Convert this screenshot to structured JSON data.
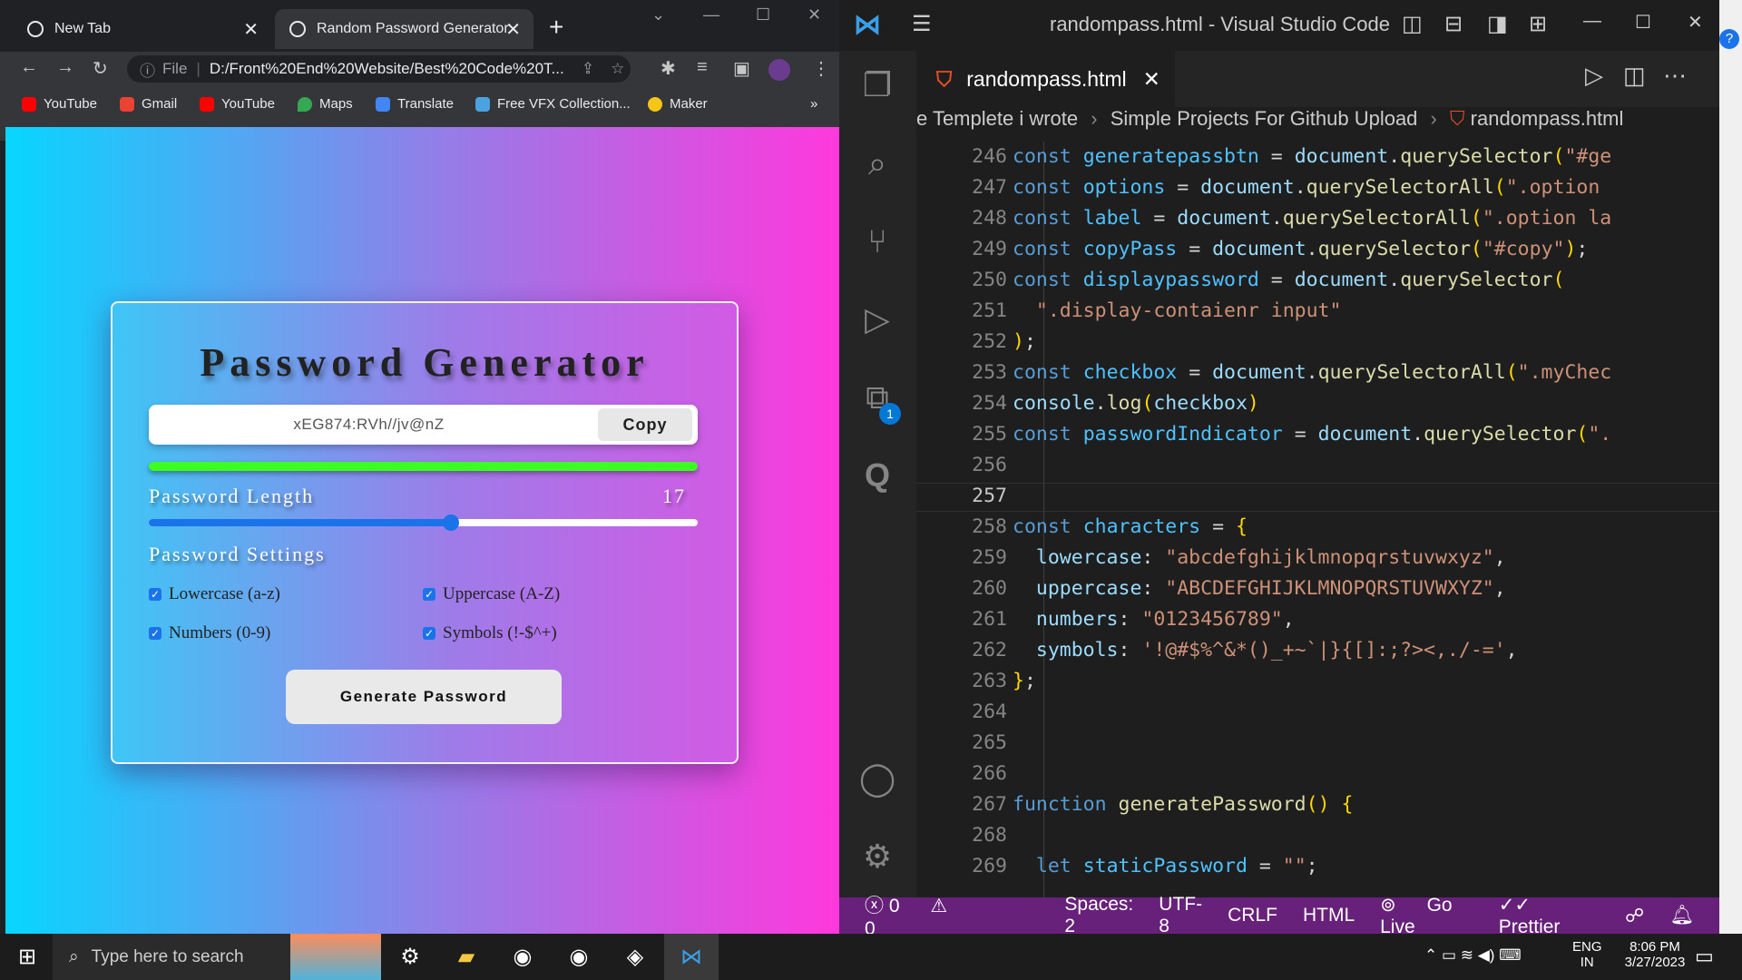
{
  "browser": {
    "tabs": [
      {
        "label": "New Tab"
      },
      {
        "label": "Random Password Generator"
      }
    ],
    "url": "D:/Front%20End%20Website/Best%20Code%20T...",
    "url_scheme": "File",
    "bookmarks": [
      "YouTube",
      "Gmail",
      "YouTube",
      "Maps",
      "Translate",
      "Free VFX Collection...",
      "Maker"
    ],
    "more_bookmarks": "»"
  },
  "app": {
    "title": "Password Generator",
    "password": "xEG874:RVh//jv@nZ",
    "copy_label": "Copy",
    "length_label": "Password Length",
    "length_value": "17",
    "length_fraction": 0.55,
    "strength_color": "#3dfc23",
    "settings_label": "Password Settings",
    "options": [
      {
        "label": "Lowercase (a-z)",
        "checked": true
      },
      {
        "label": "Uppercase (A-Z)",
        "checked": true
      },
      {
        "label": "Numbers (0-9)",
        "checked": true
      },
      {
        "label": "Symbols (!-$^+)",
        "checked": true
      }
    ],
    "generate_label": "Generate Password"
  },
  "vscode": {
    "window_title": "randompass.html - Visual Studio Code",
    "tab_label": "randompass.html",
    "breadcrumb": [
      "e Templete i wrote",
      "Simple Projects For Github Upload",
      "randompass.html"
    ],
    "extensions_badge": "1",
    "lines": [
      {
        "n": "246"
      },
      {
        "n": "247"
      },
      {
        "n": "248"
      },
      {
        "n": "249"
      },
      {
        "n": "250"
      },
      {
        "n": "251"
      },
      {
        "n": "252"
      },
      {
        "n": "253"
      },
      {
        "n": "254"
      },
      {
        "n": "255"
      },
      {
        "n": "256"
      },
      {
        "n": "257"
      },
      {
        "n": "258"
      },
      {
        "n": "259"
      },
      {
        "n": "260"
      },
      {
        "n": "261"
      },
      {
        "n": "262"
      },
      {
        "n": "263"
      },
      {
        "n": "264"
      },
      {
        "n": "265"
      },
      {
        "n": "266"
      },
      {
        "n": "267"
      },
      {
        "n": "268"
      },
      {
        "n": "269"
      }
    ],
    "code": {
      "l246_name": "generatepassbtn",
      "l246_str": "\"#ge",
      "l247_name": "options",
      "l247_str": "\".option",
      "l248_name": "label",
      "l248_str": "\".option la",
      "l249_name": "copyPass",
      "l249_str": "\"#copy\"",
      "l250_name": "displaypassword",
      "l251_str": "\".display-contaienr input\"",
      "l253_name": "checkbox",
      "l253_str": "\".myChec",
      "l254_arg": "checkbox",
      "l255_name": "passwordIndicator",
      "l255_str": "\".",
      "l258_name": "characters",
      "l259_key": "lowercase",
      "l259_val": "\"abcdefghijklmnopqrstuvwxyz\"",
      "l260_key": "uppercase",
      "l260_val": "\"ABCDEFGHIJKLMNOPQRSTUVWXYZ\"",
      "l261_key": "numbers",
      "l261_val": "\"0123456789\"",
      "l262_key": "symbols",
      "l262_val": "'!@#$%^&*()_+~`|}{[]:;?><,./-='",
      "l267_fn": "generatePassword",
      "l269_name": "staticPassword",
      "l269_val": "\"\""
    },
    "status": {
      "errors": "0",
      "warnings": "0",
      "spaces": "Spaces: 2",
      "encoding": "UTF-8",
      "eol": "CRLF",
      "language": "HTML",
      "golive": "Go Live",
      "prettier": "Prettier"
    }
  },
  "taskbar": {
    "search_placeholder": "Type here to search",
    "lang": "ENG",
    "region": "IN",
    "time": "8:06 PM",
    "date": "3/27/2023"
  }
}
